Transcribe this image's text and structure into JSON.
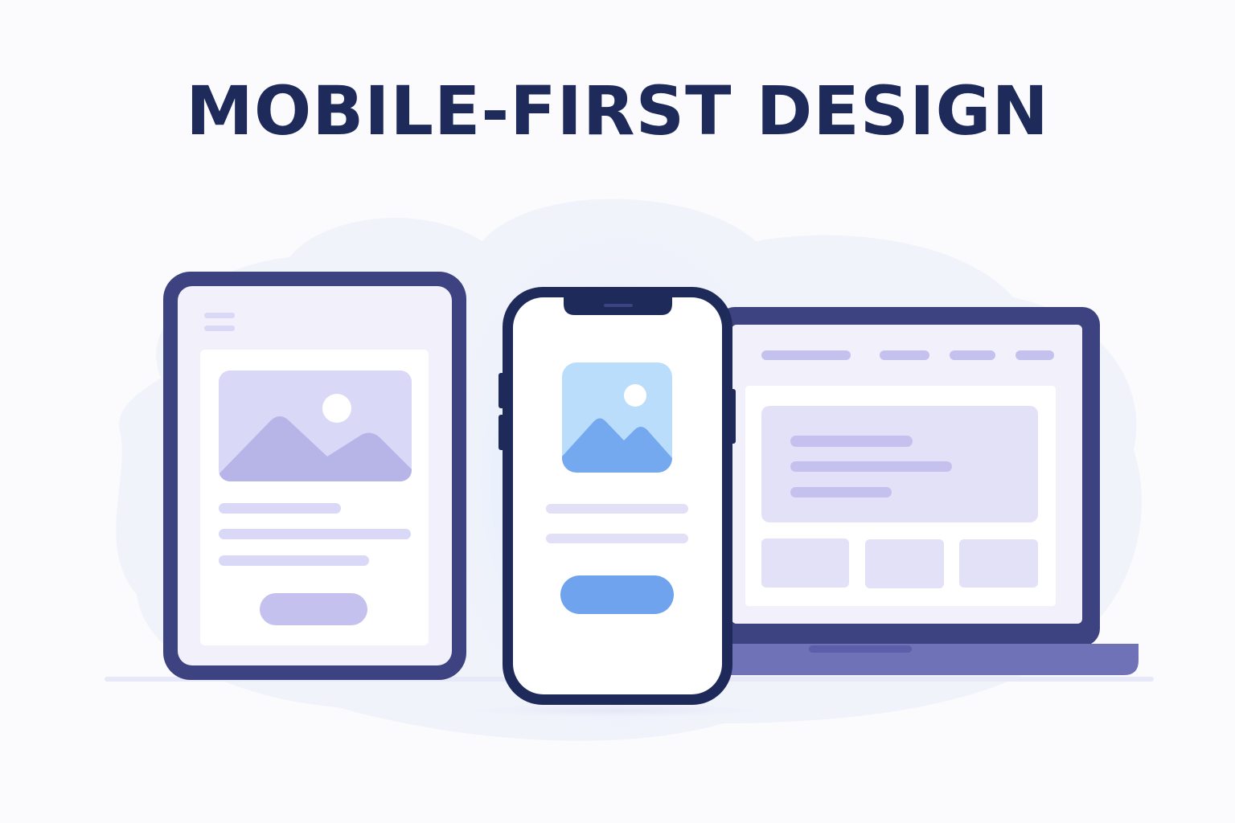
{
  "heading": {
    "text": "MOBILE-FIRST DESIGN"
  },
  "colors": {
    "heading": "#1e2a5a",
    "frame": "#3d4280",
    "laptop_base": "#6f72b6",
    "tablet_screen": "#f1f0fb",
    "tablet_card": "#ffffff",
    "lavender_block": "#d9d8f6",
    "lavender_shape": "#b7b4e8",
    "lavender_button": "#c4c1ef",
    "phone_screen": "#ffffff",
    "phone_image_bg": "#b9ddfb",
    "phone_mountain": "#74a9f0",
    "phone_button": "#6fa3ee",
    "phone_text_line": "#e1e0f7",
    "backdrop_blob": "#eef1fb",
    "glow": "#cfe4fc"
  },
  "icons": {
    "tablet_image": "image-placeholder-icon",
    "phone_image": "image-placeholder-icon",
    "tablet_menu": "hamburger-menu-icon"
  }
}
